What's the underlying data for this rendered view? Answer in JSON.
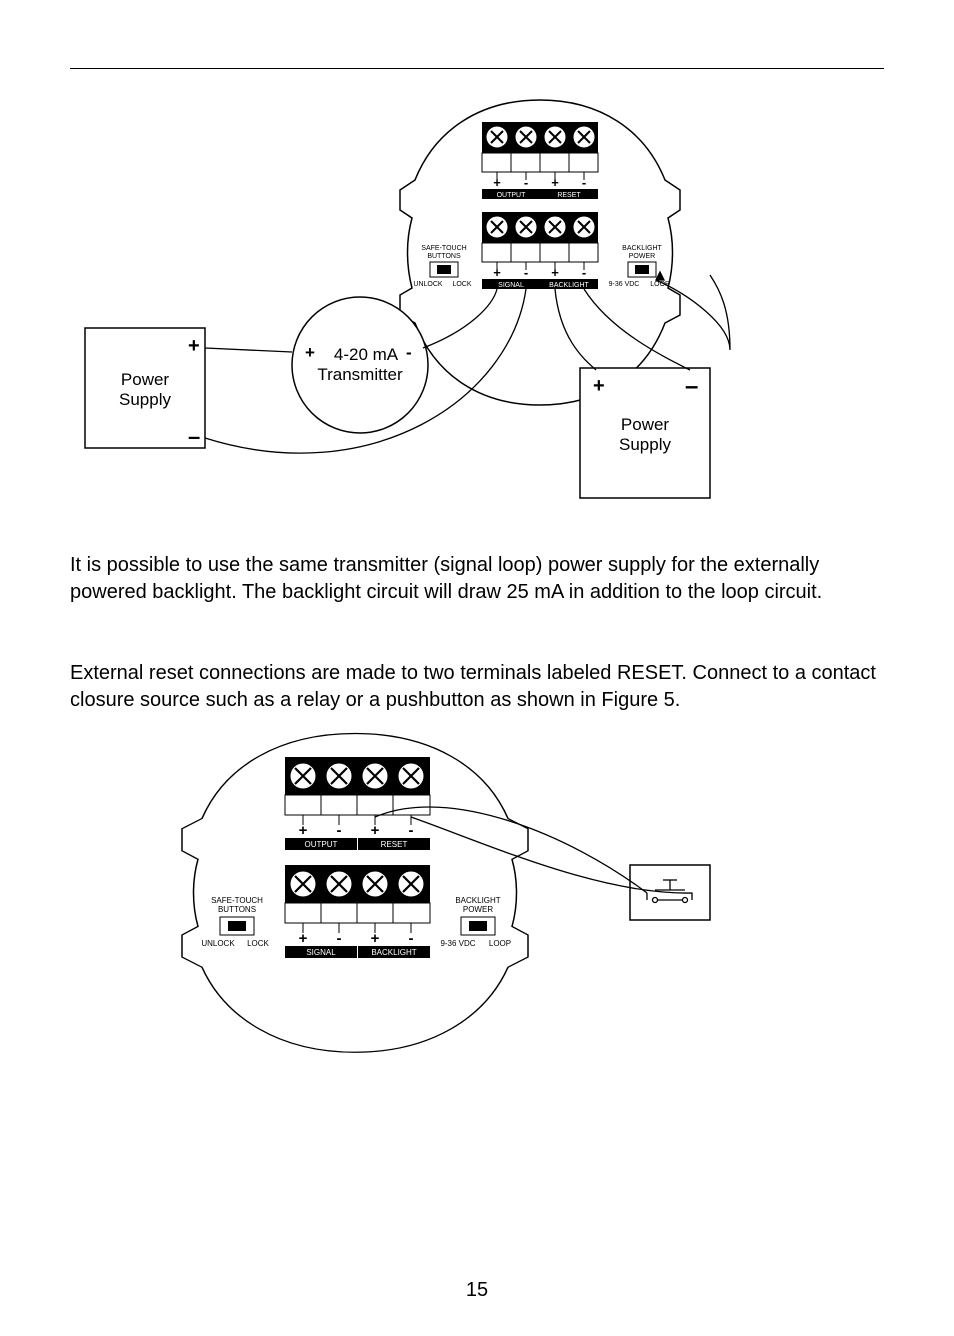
{
  "page_number": "15",
  "paragraph1": "It is possible to use the same transmitter (signal loop) power supply for the externally powered backlight. The backlight circuit will draw 25 mA in addition to the loop circuit.",
  "paragraph2": "External reset connections are made to two terminals labeled RESET. Connect to a contact closure source such as a relay or a pushbutton as shown in Figure 5.",
  "diagram1": {
    "power_supply_left": "Power\nSupply",
    "power_supply_right": "Power\nSupply",
    "transmitter_line1": "4-20 mA",
    "transmitter_line2": "Transmitter",
    "plus": "+",
    "minus": "-",
    "safe_touch_l1": "SAFE-TOUCH",
    "safe_touch_l2": "BUTTONS",
    "unlock": "UNLOCK",
    "lock": "LOCK",
    "backlight_power_l1": "BACKLIGHT",
    "backlight_power_l2": "POWER",
    "vdc": "9-36 VDC",
    "loop": "LOOP",
    "output": "OUTPUT",
    "reset": "RESET",
    "signal": "SIGNAL",
    "backlight": "BACKLIGHT"
  },
  "diagram2": {
    "safe_touch_l1": "SAFE-TOUCH",
    "safe_touch_l2": "BUTTONS",
    "unlock": "UNLOCK",
    "lock": "LOCK",
    "backlight_power_l1": "BACKLIGHT",
    "backlight_power_l2": "POWER",
    "vdc": "9-36 VDC",
    "loop": "LOOP",
    "output": "OUTPUT",
    "reset": "RESET",
    "signal": "SIGNAL",
    "backlight": "BACKLIGHT",
    "plus": "+",
    "minus": "-"
  }
}
